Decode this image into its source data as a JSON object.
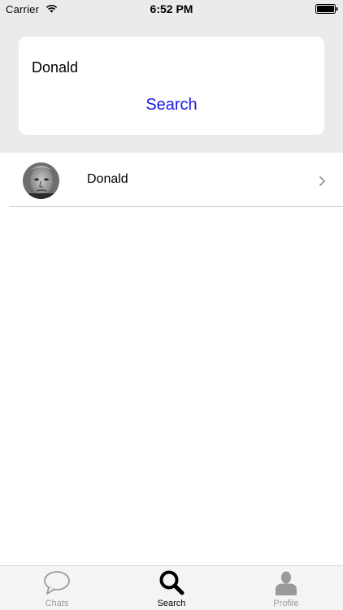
{
  "status_bar": {
    "carrier": "Carrier",
    "time": "6:52 PM"
  },
  "search": {
    "query": "Donald",
    "button_label": "Search"
  },
  "results": [
    {
      "name": "Donald"
    }
  ],
  "tabs": [
    {
      "label": "Chats",
      "icon": "chat-bubble-icon",
      "active": false
    },
    {
      "label": "Search",
      "icon": "magnifier-icon",
      "active": true
    },
    {
      "label": "Profile",
      "icon": "person-icon",
      "active": false
    }
  ],
  "colors": {
    "accent": "#1a1ae6",
    "panel_bg": "#ebebeb",
    "tab_inactive": "#9a9a9a"
  }
}
